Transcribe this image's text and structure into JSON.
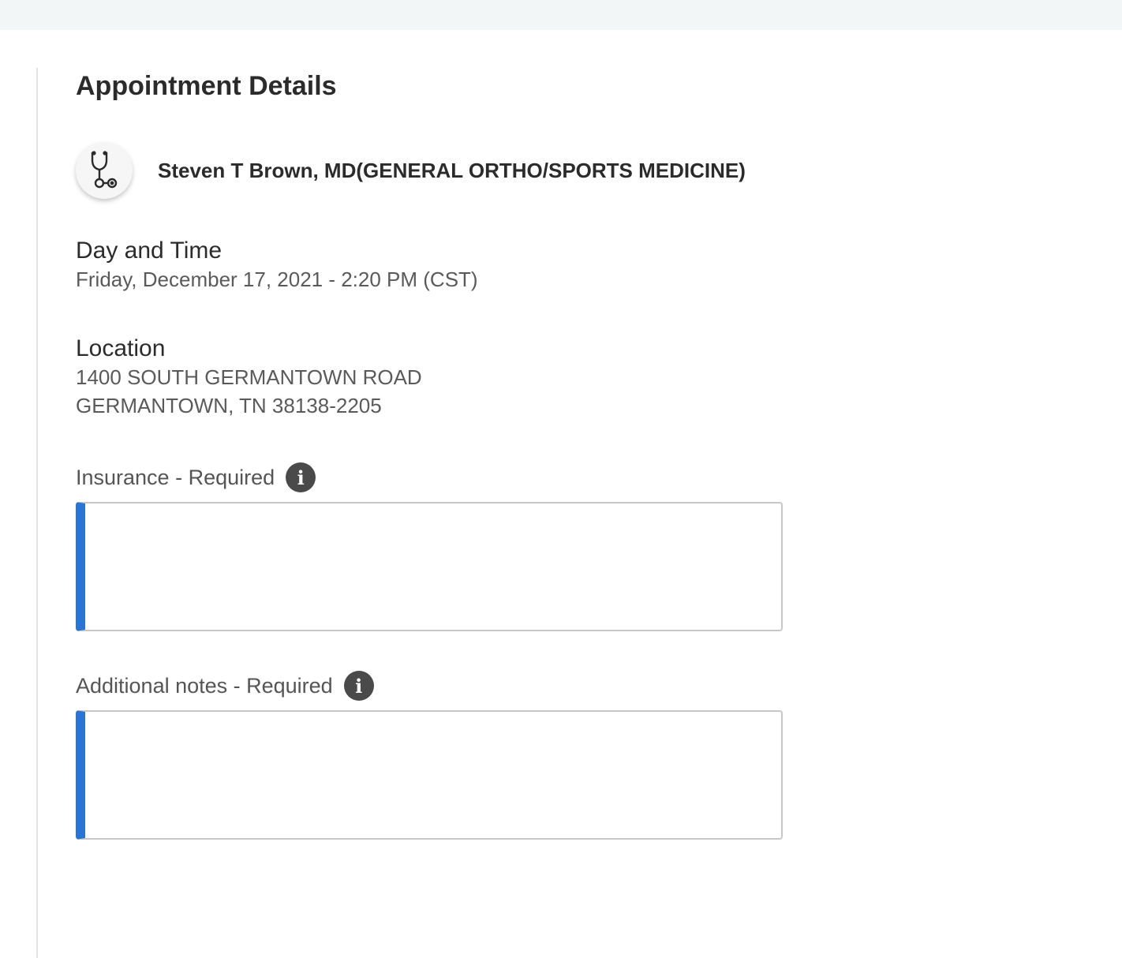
{
  "page": {
    "title": "Appointment Details"
  },
  "provider": {
    "name": "Steven T Brown, MD(GENERAL ORTHO/SPORTS MEDICINE)",
    "icon": "stethoscope-icon"
  },
  "day_time": {
    "label": "Day and Time",
    "value": "Friday, December 17, 2021 - 2:20 PM (CST)"
  },
  "location": {
    "label": "Location",
    "line1": "1400 SOUTH GERMANTOWN ROAD",
    "line2": "GERMANTOWN, TN 38138-2205"
  },
  "insurance": {
    "label": "Insurance - Required",
    "value": "",
    "info_icon": "i"
  },
  "notes": {
    "label": "Additional notes - Required",
    "value": "",
    "info_icon": "i"
  },
  "colors": {
    "accent": "#2a74d4",
    "top_bar": "#f3f6f7",
    "info_icon_bg": "#4a4a4a"
  }
}
